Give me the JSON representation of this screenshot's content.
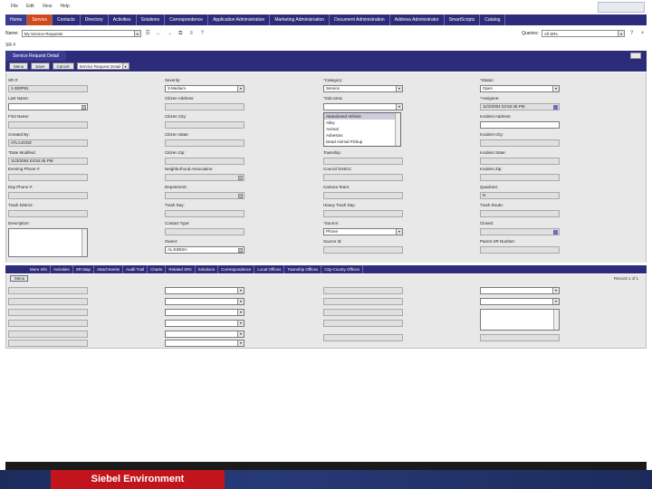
{
  "menubar": {
    "items": [
      "File",
      "Edit",
      "View",
      "Help"
    ],
    "brand_line1": "",
    "brand_line2": ""
  },
  "tabs": [
    {
      "label": "Home"
    },
    {
      "label": "Service"
    },
    {
      "label": "Contacts"
    },
    {
      "label": "Directory"
    },
    {
      "label": "Activities"
    },
    {
      "label": "Solutions"
    },
    {
      "label": "Correspondence"
    },
    {
      "label": "Application Administration"
    },
    {
      "label": "Marketing Administration"
    },
    {
      "label": "Document Administration"
    },
    {
      "label": "Address Administrator"
    },
    {
      "label": "SmartScripts"
    },
    {
      "label": "Catalog"
    }
  ],
  "querybar": {
    "show_label": "Name:",
    "show_value": "My Service Requests",
    "queries_label": "Queries:",
    "queries_value": "All SRs"
  },
  "breadcrumb": "SR #",
  "applet": {
    "title": "Service Request Detail",
    "menu_label": "Menu",
    "save_label": "Save",
    "cancel_label": "Cancel",
    "view_select": "Service Request Detail"
  },
  "form": {
    "sr_label": "SR #:",
    "sr_value": "1-383P91",
    "last_name_label": "Last Name:",
    "first_name_label": "First Name:",
    "created_by_label": "Created By:",
    "created_by_value": "ATLAJOOZ",
    "date_modified_label": "Date Modified:",
    "date_modified_value": "11/3/2004 03:52:45 PM",
    "evening_phone_label": "Evening Phone #:",
    "day_phone_label": "Day Phone #:",
    "trash_district_label": "Trash District:",
    "description_label": "Description:",
    "severity_label": "Severity:",
    "severity_value": "3-Medium",
    "citizen_address_label": "Citizen Address:",
    "citizen_city_label": "Citizen City:",
    "citizen_state_label": "Citizen State:",
    "citizen_zip_label": "Citizen Zip:",
    "neighborhood_label": "Neighborhood Association:",
    "department_label": "Department:",
    "trash_day_label": "Trash Day:",
    "contact_type_label": "Contact Type:",
    "owner_label": "Owner:",
    "owner_value": "ALJUBISH",
    "category_label": "Category:",
    "category_value": "Service",
    "subtype_label": "Sub-area:",
    "township_label": "Township:",
    "council_district_label": "Council District:",
    "camera_team_label": "Camera Team:",
    "heavy_trash_label": "Heavy Trash Day:",
    "source_label": "Source:",
    "source_value": "Phone",
    "source_id_label": "Source Id:",
    "status_label": "Status:",
    "status_value": "Open",
    "assignee_label": "Assignee:",
    "assignee_value": "11/3/2004 03:52:45 PM",
    "incident_address_label": "Incident Address:",
    "incident_city_label": "Incident City:",
    "incident_state_label": "Incident State:",
    "incident_zip_label": "Incident Zip:",
    "quadrant_label": "Quadrant:",
    "quadrant_value": "N",
    "trash_route_label": "Trash Route:",
    "closed_label": "Closed:",
    "parent_sr_label": "Parent SR Number:"
  },
  "subarea_options": [
    "Abandoned Vehicle",
    "Alley",
    "Animal",
    "Asbestos",
    "Dead Animal Pickup"
  ],
  "subtabs": [
    "More Info",
    "Activities",
    "SR Map",
    "Attachments",
    "Audit Trail",
    "Charts",
    "Related SRs",
    "Solutions",
    "Correspondence",
    "Local Offices",
    "Township Offices",
    "City-County Offices"
  ],
  "subform": {
    "menu_label": "Menu",
    "record_count": "Record 1 of 1"
  },
  "footer": {
    "message": "",
    "page": ""
  },
  "slide_title": "Siebel Environment"
}
